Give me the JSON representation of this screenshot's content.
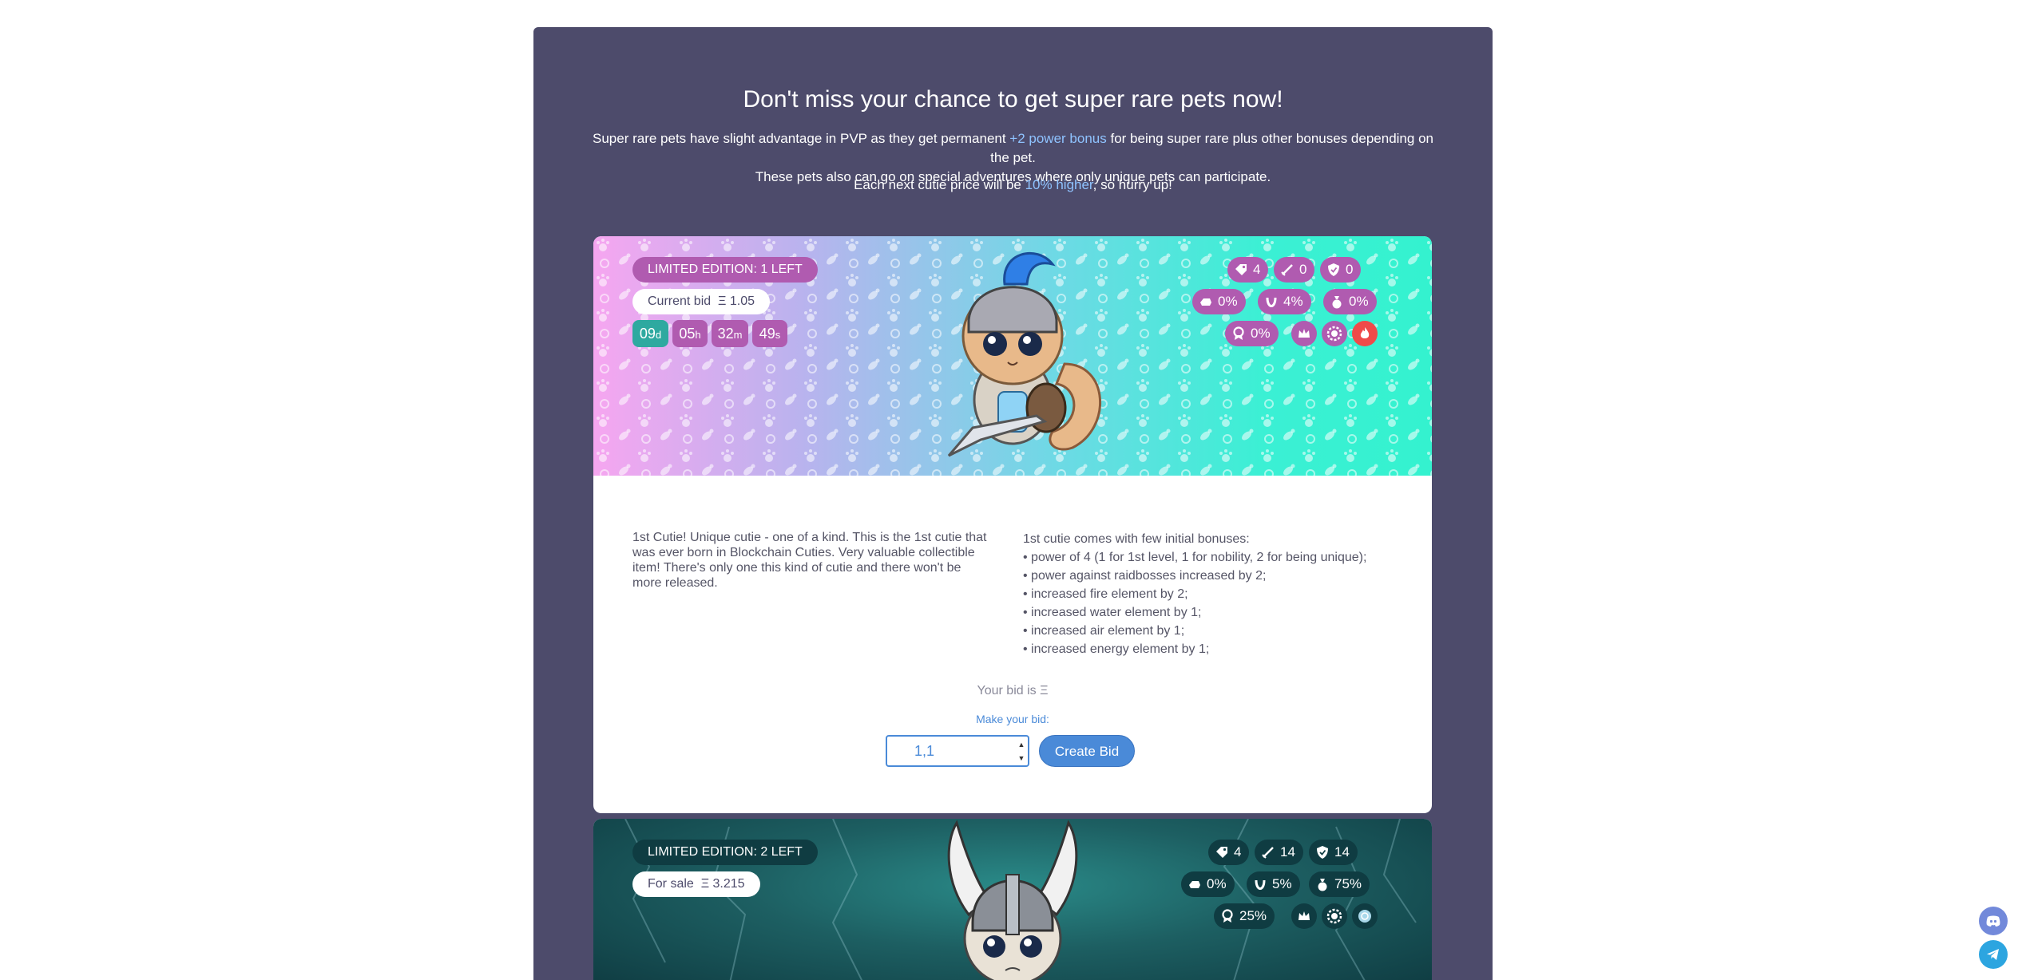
{
  "header": {
    "title": "Don't miss your chance to get super rare pets now!",
    "intro_part1": "Super rare pets have slight advantage in PVP as they get permanent ",
    "intro_highlight": "+2 power bonus",
    "intro_part2": " for being super rare plus other bonuses depending on the pet.",
    "intro_line2": "These pets also can go on special adventures where only unique pets can participate.",
    "hurry_part1": "Each next cutie price will be ",
    "hurry_highlight": "10% higher",
    "hurry_part2": ", so hurry up!"
  },
  "pet1": {
    "edition": "LIMITED EDITION: 1 LEFT",
    "price_label": "Current bid",
    "price_value": "Ξ 1.05",
    "timer": [
      {
        "value": "09",
        "unit": "d"
      },
      {
        "value": "05",
        "unit": "h"
      },
      {
        "value": "32",
        "unit": "m"
      },
      {
        "value": "49",
        "unit": "s"
      }
    ],
    "stats": {
      "tag": "4",
      "attack": "0",
      "defense": "0",
      "speed": "0%",
      "luck": "4%",
      "bag": "0%",
      "medal": "0%"
    },
    "description": "1st Cutie! Unique cutie - one of a kind. This is the 1st cutie that was ever born in Blockchain Cuties. Very valuable collectible item! There's only one this kind of cutie and there won't be more released.",
    "bonuses_title": "1st cutie comes with few initial bonuses:",
    "bonuses": [
      "• power of 4 (1 for 1st level, 1 for nobility, 2 for being unique);",
      "• power against raidbosses increased by 2;",
      "• increased fire element by 2;",
      "• increased water element by 1;",
      "• increased air element by 1;",
      "• increased energy element by 1;"
    ],
    "your_bid": "Your bid is Ξ",
    "make_bid": "Make your bid:",
    "bid_value": "1,1",
    "create_bid": "Create Bid"
  },
  "pet2": {
    "edition": "LIMITED EDITION: 2 LEFT",
    "price_label": "For sale",
    "price_value": "Ξ 3.215",
    "stats": {
      "tag": "4",
      "attack": "14",
      "defense": "14",
      "speed": "0%",
      "luck": "5%",
      "bag": "75%",
      "medal": "25%"
    }
  },
  "colors": {
    "panel": "#4d4b6b",
    "accent_blue": "#4a8ad8",
    "badge_purple": "#b05bb0",
    "timer_teal": "#2ea9a0",
    "badge_dark_teal": "#0f3c42",
    "fire_red": "#ef4a4a"
  },
  "icons": [
    "tag-icon",
    "sword-icon",
    "shield-icon",
    "speed-icon",
    "horseshoe-icon",
    "bag-icon",
    "medal-icon",
    "crown-icon",
    "chip-icon",
    "fire-icon",
    "discord-icon",
    "telegram-icon"
  ]
}
